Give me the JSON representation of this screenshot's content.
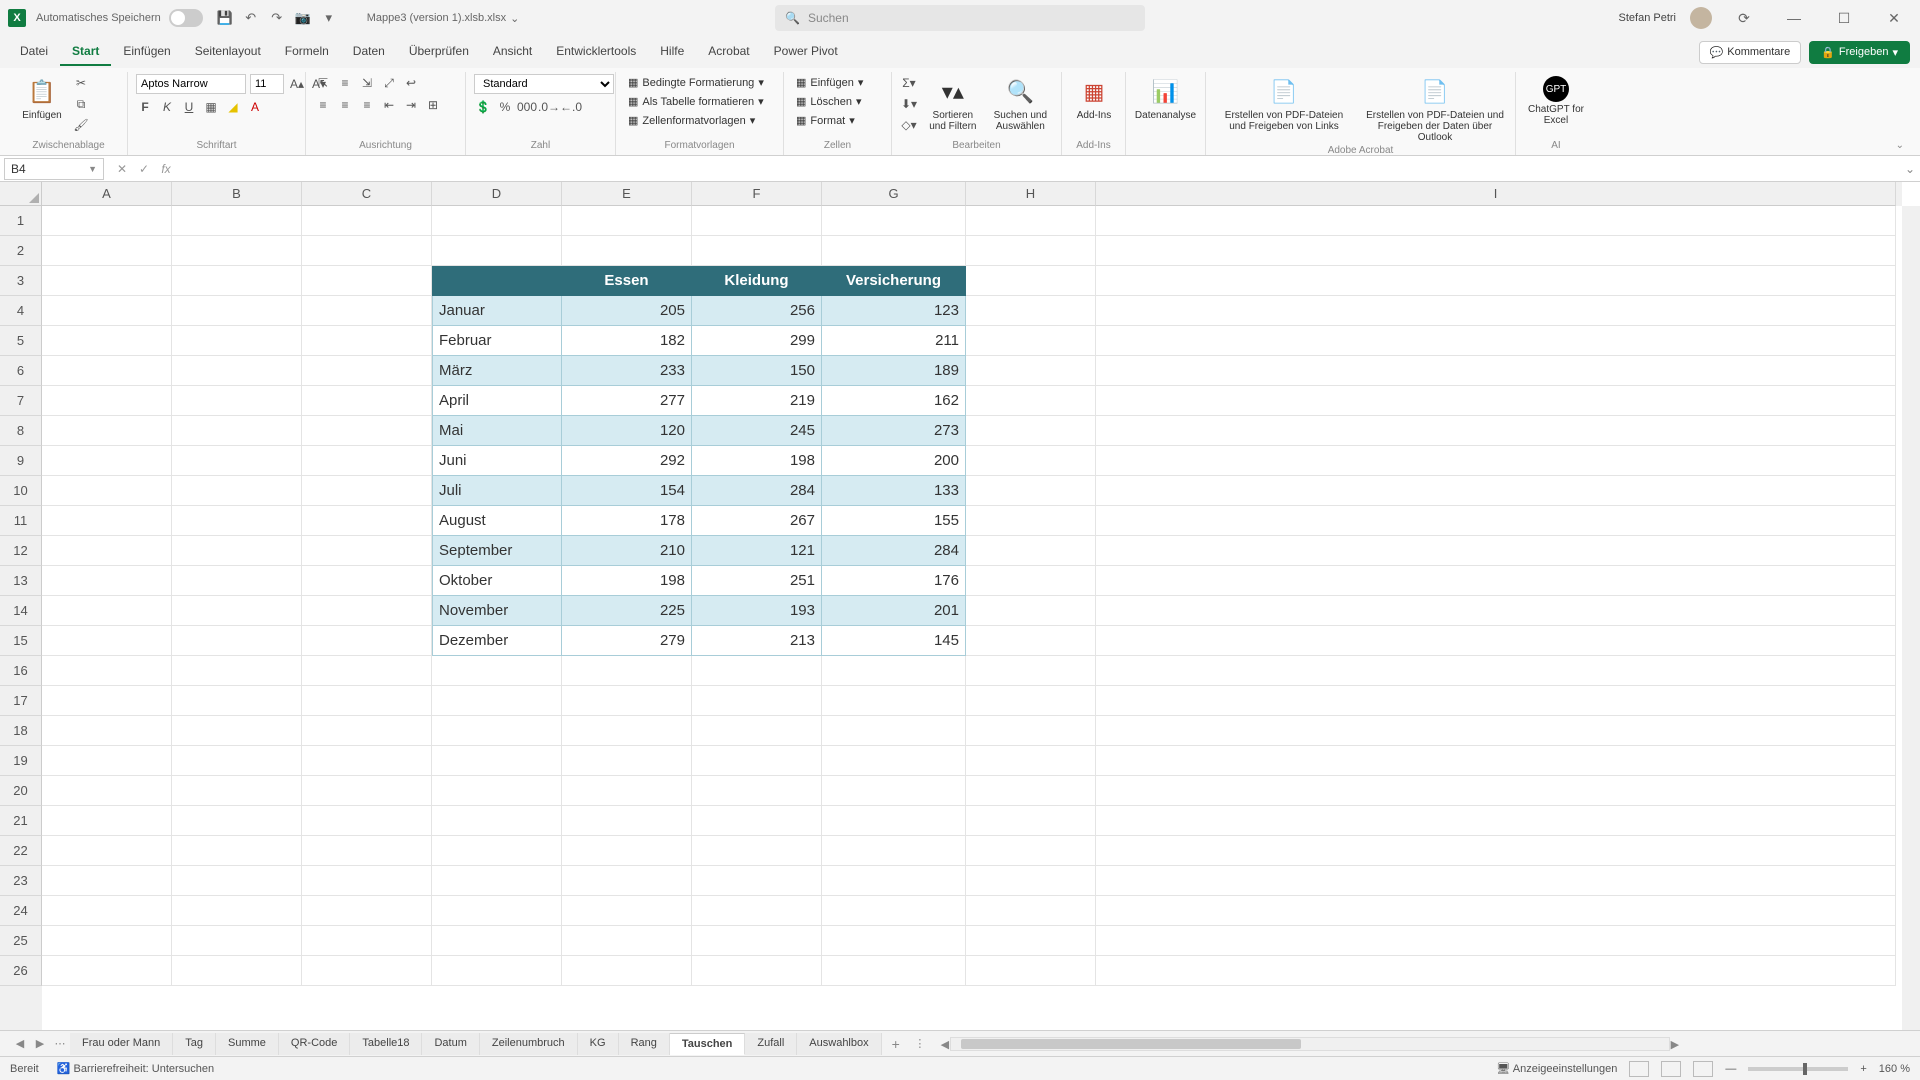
{
  "titlebar": {
    "autosave_label": "Automatisches Speichern",
    "filename": "Mappe3 (version 1).xlsb.xlsx",
    "search_placeholder": "Suchen",
    "username": "Stefan Petri"
  },
  "tabs": {
    "items": [
      "Datei",
      "Start",
      "Einfügen",
      "Seitenlayout",
      "Formeln",
      "Daten",
      "Überprüfen",
      "Ansicht",
      "Entwicklertools",
      "Hilfe",
      "Acrobat",
      "Power Pivot"
    ],
    "active_index": 1,
    "comments": "Kommentare",
    "share": "Freigeben"
  },
  "ribbon": {
    "clipboard": {
      "paste": "Einfügen",
      "label": "Zwischenablage"
    },
    "font": {
      "name": "Aptos Narrow",
      "size": "11",
      "label": "Schriftart"
    },
    "align": {
      "label": "Ausrichtung"
    },
    "number": {
      "format": "Standard",
      "label": "Zahl"
    },
    "styles": {
      "cond": "Bedingte Formatierung",
      "table": "Als Tabelle formatieren",
      "cell": "Zellenformatvorlagen",
      "label": "Formatvorlagen"
    },
    "cells": {
      "insert": "Einfügen",
      "delete": "Löschen",
      "format": "Format",
      "label": "Zellen"
    },
    "editing": {
      "sort": "Sortieren und Filtern",
      "find": "Suchen und Auswählen",
      "label": "Bearbeiten"
    },
    "addins": {
      "btn": "Add-Ins",
      "label": "Add-Ins"
    },
    "analysis": {
      "btn": "Datenanalyse"
    },
    "acrobat": {
      "pdf1": "Erstellen von PDF-Dateien und Freigeben von Links",
      "pdf2": "Erstellen von PDF-Dateien und Freigeben der Daten über Outlook",
      "label": "Adobe Acrobat"
    },
    "ai": {
      "btn": "ChatGPT for Excel",
      "label": "AI"
    }
  },
  "namebox": "B4",
  "formula": "",
  "columns": [
    "A",
    "B",
    "C",
    "D",
    "E",
    "F",
    "G",
    "H",
    "I"
  ],
  "rows_visible": 26,
  "table": {
    "headers": [
      "",
      "Essen",
      "Kleidung",
      "Versicherung"
    ],
    "rows": [
      {
        "m": "Januar",
        "v": [
          205,
          256,
          123
        ]
      },
      {
        "m": "Februar",
        "v": [
          182,
          299,
          211
        ]
      },
      {
        "m": "März",
        "v": [
          233,
          150,
          189
        ]
      },
      {
        "m": "April",
        "v": [
          277,
          219,
          162
        ]
      },
      {
        "m": "Mai",
        "v": [
          120,
          245,
          273
        ]
      },
      {
        "m": "Juni",
        "v": [
          292,
          198,
          200
        ]
      },
      {
        "m": "Juli",
        "v": [
          154,
          284,
          133
        ]
      },
      {
        "m": "August",
        "v": [
          178,
          267,
          155
        ]
      },
      {
        "m": "September",
        "v": [
          210,
          121,
          284
        ]
      },
      {
        "m": "Oktober",
        "v": [
          198,
          251,
          176
        ]
      },
      {
        "m": "November",
        "v": [
          225,
          193,
          201
        ]
      },
      {
        "m": "Dezember",
        "v": [
          279,
          213,
          145
        ]
      }
    ]
  },
  "sheets": {
    "items": [
      "Frau oder Mann",
      "Tag",
      "Summe",
      "QR-Code",
      "Tabelle18",
      "Datum",
      "Zeilenumbruch",
      "KG",
      "Rang",
      "Tauschen",
      "Zufall",
      "Auswahlbox"
    ],
    "active_index": 9
  },
  "statusbar": {
    "ready": "Bereit",
    "access": "Barrierefreiheit: Untersuchen",
    "display": "Anzeigeeinstellungen",
    "zoom": "160 %"
  }
}
